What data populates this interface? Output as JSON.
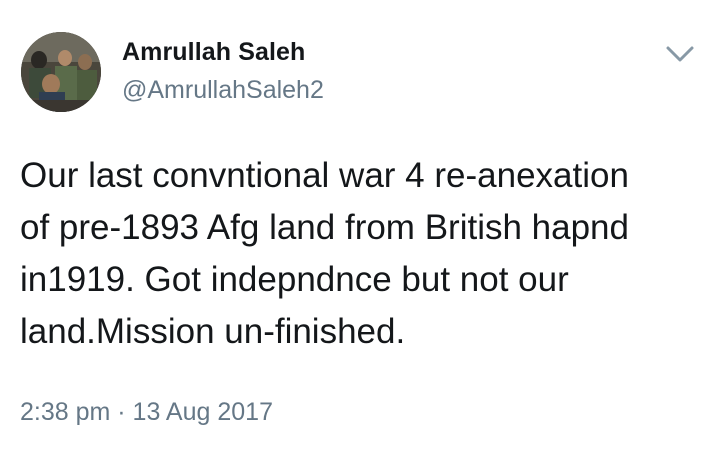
{
  "author": {
    "name": "Amrullah Saleh",
    "handle": "@AmrullahSaleh2",
    "avatar_icon": "profile-photo"
  },
  "menu": {
    "icon": "chevron-down-icon"
  },
  "tweet": {
    "text": "Our last convntional war 4 re-anexation\nof pre-1893 Afg land from British hapnd\nin1919. Got indepndnce but not our\nland.Mission un-finished.",
    "timestamp": "2:38 pm · 13 Aug 2017"
  },
  "colors": {
    "text_primary": "#14171a",
    "text_secondary": "#657786",
    "background": "#ffffff"
  }
}
